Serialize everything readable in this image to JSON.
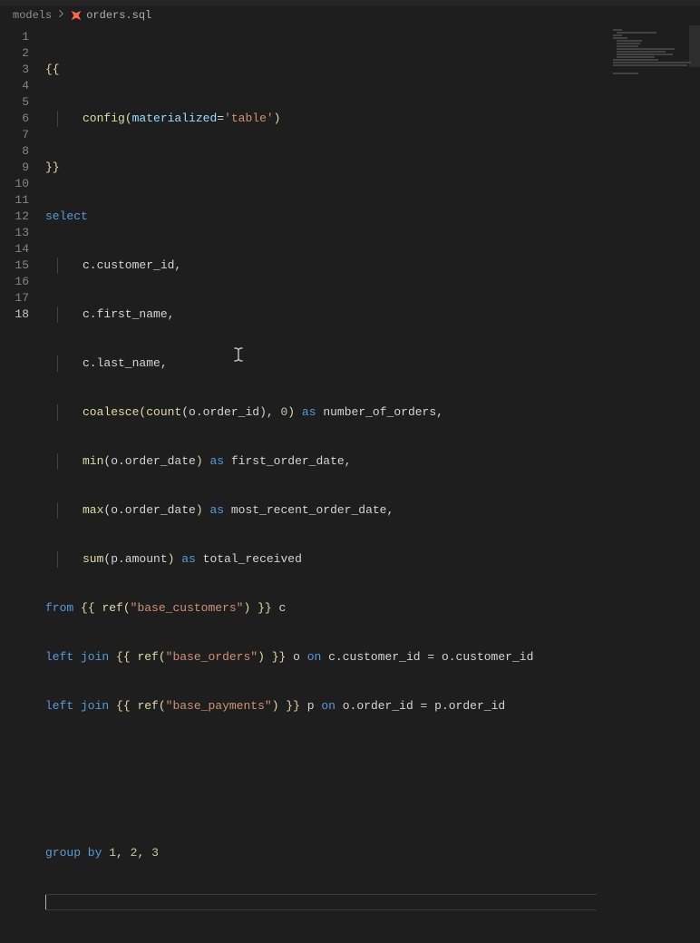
{
  "breadcrumbs": {
    "folder": "models",
    "filename": "orders.sql"
  },
  "lineNumbers": [
    "1",
    "2",
    "3",
    "4",
    "5",
    "6",
    "7",
    "8",
    "9",
    "10",
    "11",
    "12",
    "13",
    "14",
    "15",
    "16",
    "17",
    "18"
  ],
  "activeLine": 18,
  "code": {
    "l1": "{{",
    "l2_fn": "config",
    "l2_arg": "materialized",
    "l2_eq": "=",
    "l2_str": "'table'",
    "l3": "}}",
    "l4": "select",
    "l5": "c.customer_id,",
    "l6": "c.first_name,",
    "l7": "c.last_name,",
    "l8_fn1": "coalesce",
    "l8_fn2": "count",
    "l8_a": "(o.order_id)",
    "l8_b": ", ",
    "l8_zero": "0",
    "l8_c": ")",
    "l8_as": " as ",
    "l8_d": "number_of_orders,",
    "l9_fn": "min",
    "l9_a": "(o.order_date",
    "l9_b": ")",
    "l9_as": " as ",
    "l9_c": "first_order_date,",
    "l10_fn": "max",
    "l10_a": "(o.order_date",
    "l10_b": ")",
    "l10_as": " as ",
    "l10_c": "most_recent_order_date,",
    "l11_fn": "sum",
    "l11_a": "(p.amount",
    "l11_b": ")",
    "l11_as": " as ",
    "l11_c": "total_received",
    "l12_from": "from",
    "l12_b1": " {{ ",
    "l12_ref": "ref",
    "l12_p1": "(",
    "l12_str": "\"base_customers\"",
    "l12_p2": ")",
    "l12_b2": " }} ",
    "l12_al": "c",
    "l13_lj": "left join",
    "l13_b1": " {{ ",
    "l13_ref": "ref",
    "l13_p1": "(",
    "l13_str": "\"base_orders\"",
    "l13_p2": ")",
    "l13_b2": " }} ",
    "l13_al": "o ",
    "l13_on": "on",
    "l13_cond": " c.customer_id = o.customer_id",
    "l14_lj": "left join",
    "l14_b1": " {{ ",
    "l14_ref": "ref",
    "l14_p1": "(",
    "l14_str": "\"base_payments\"",
    "l14_p2": ")",
    "l14_b2": " }} ",
    "l14_al": "p ",
    "l14_on": "on",
    "l14_cond": " o.order_id = p.order_id",
    "l17_gb": "group by",
    "l17_sp": " ",
    "l17_n1": "1",
    "l17_c1": ", ",
    "l17_n2": "2",
    "l17_c2": ", ",
    "l17_n3": "3"
  },
  "colors": {
    "breadcrumbActive": "#b0b0b0"
  }
}
